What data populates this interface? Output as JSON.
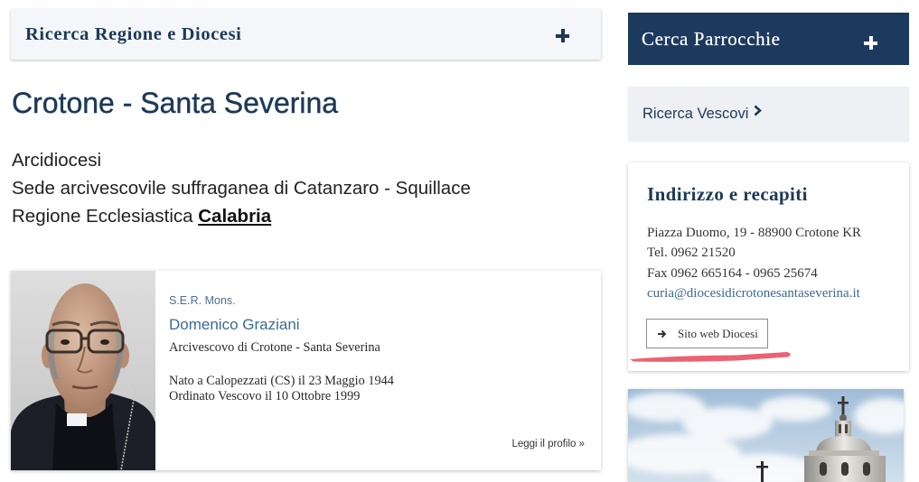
{
  "colors": {
    "navy": "#1b3a5e",
    "title_navy": "#1d3957",
    "link_blue": "#3b6b96",
    "panel_light": "#f4f6f9",
    "panel_grey": "#eef0f3",
    "highlight": "#e8475a",
    "text": "#222222"
  },
  "left": {
    "search_region": {
      "label": "Ricerca Regione e Diocesi",
      "icon": "plus-icon"
    },
    "diocese": {
      "title": "Crotone - Santa Severina",
      "type": "Arcidiocesi",
      "see": "Sede arcivescovile suffraganea di Catanzaro - Squillace",
      "region_prefix": "Regione Ecclesiastica",
      "region_link": "Calabria"
    },
    "bishop": {
      "honorific": "S.E.R. Mons.",
      "name": "Domenico Graziani",
      "role": "Arcivescovo di Crotone - Santa Severina",
      "born": "Nato a Calopezzati (CS) il 23 Maggio 1944",
      "ordained": "Ordinato Vescovo il 10 Ottobre 1999",
      "profile_link": "Leggi il profilo »"
    }
  },
  "right": {
    "search_parishes": {
      "label": "Cerca Parrocchie",
      "icon": "plus-icon"
    },
    "search_bishops": {
      "label": "Ricerca Vescovi",
      "icon": "chevron-right-icon"
    },
    "contacts": {
      "title": "Indirizzo e recapiti",
      "address": "Piazza Duomo, 19 - 88900 Crotone KR",
      "phone": "Tel. 0962 21520",
      "fax": "Fax 0962 665164 - 0965 25674",
      "email": "curia@diocesidicrotonesantaseverina.it",
      "website_button": "Sito web Diocesi",
      "website_icon": "arrow-right-icon"
    }
  }
}
